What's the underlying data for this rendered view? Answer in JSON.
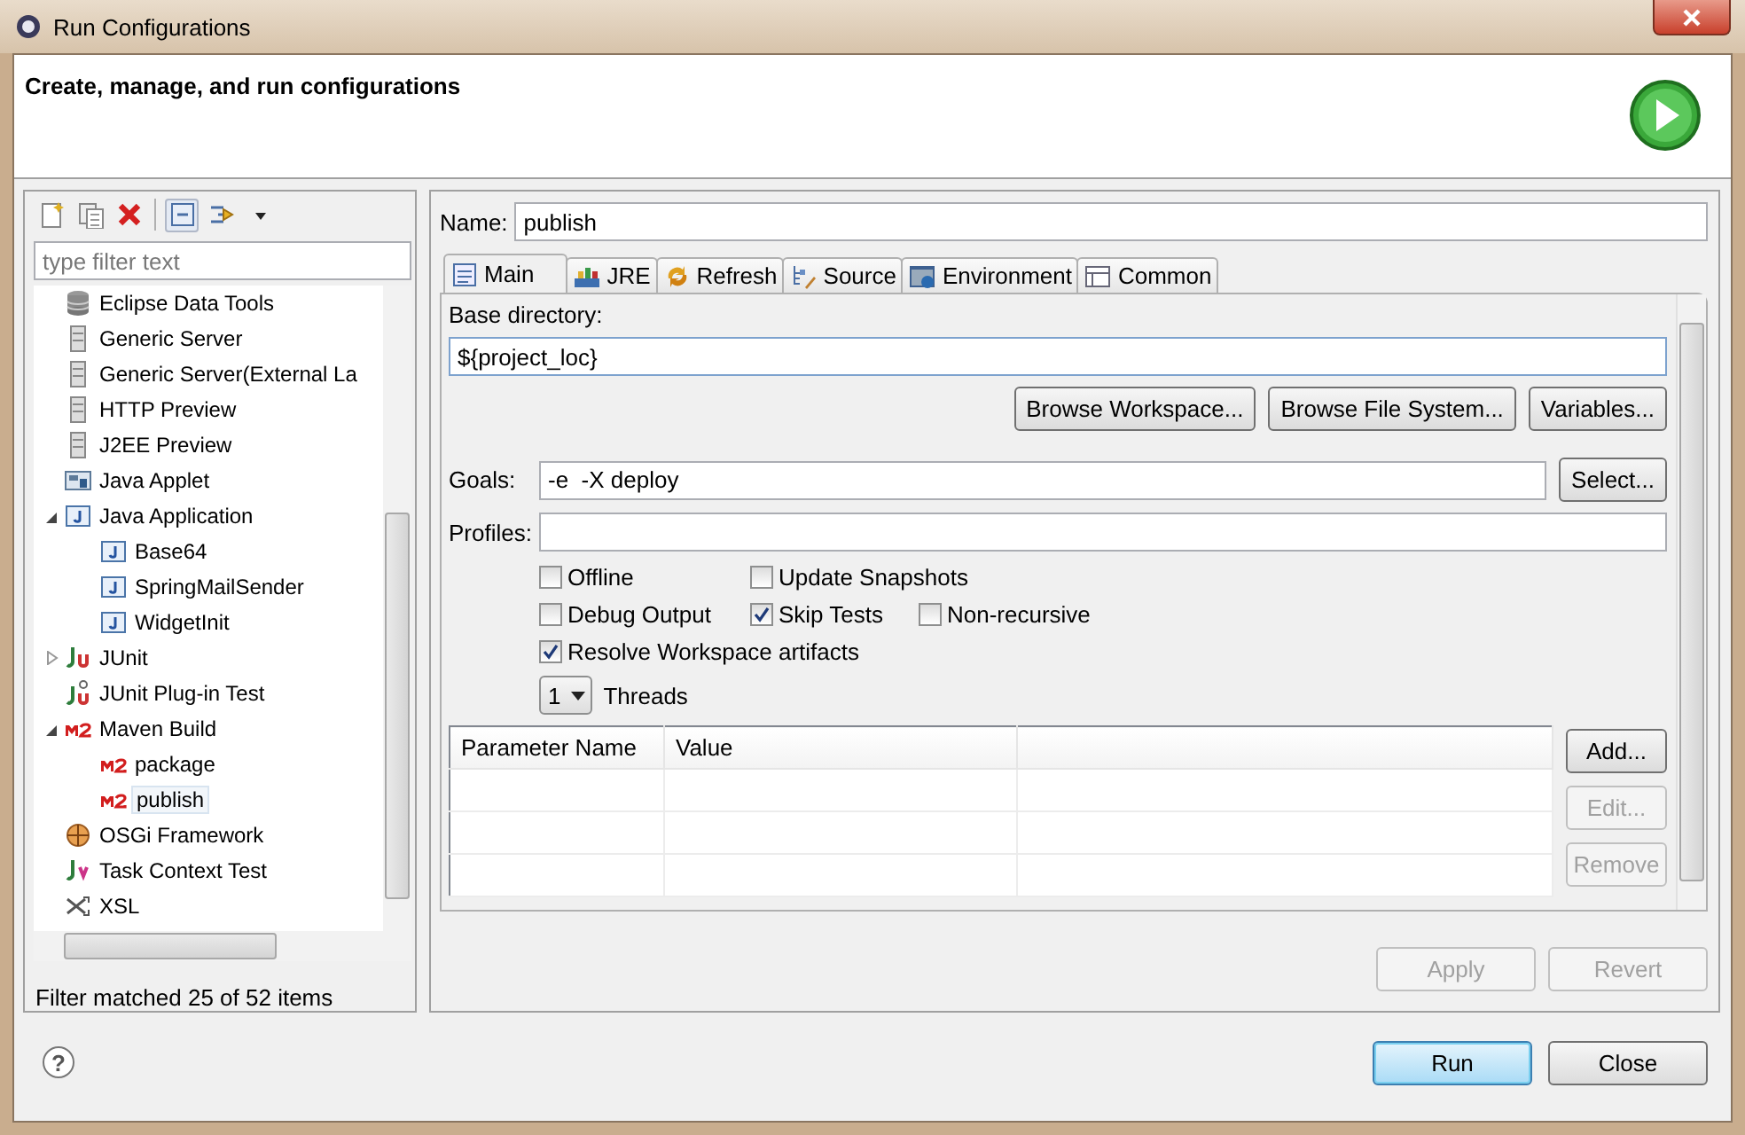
{
  "window": {
    "title": "Run Configurations"
  },
  "header": {
    "title": "Create, manage, and run configurations"
  },
  "filter": {
    "placeholder": "type filter text"
  },
  "tree": [
    {
      "label": "Eclipse Data Tools",
      "kind": "database",
      "selected": false
    },
    {
      "label": "Generic Server",
      "kind": "server",
      "selected": false
    },
    {
      "label": "Generic Server(External La",
      "kind": "server",
      "selected": false
    },
    {
      "label": "HTTP Preview",
      "kind": "server",
      "selected": false
    },
    {
      "label": "J2EE Preview",
      "kind": "server",
      "selected": false
    },
    {
      "label": "Java Applet",
      "kind": "applet",
      "selected": false
    },
    {
      "label": "Java Application",
      "kind": "java",
      "selected": false,
      "expanded": true,
      "children": [
        {
          "label": "Base64",
          "kind": "java",
          "selected": false
        },
        {
          "label": "SpringMailSender",
          "kind": "java",
          "selected": false
        },
        {
          "label": "WidgetInit",
          "kind": "java",
          "selected": false
        }
      ]
    },
    {
      "label": "JUnit",
      "kind": "junit",
      "selected": false,
      "expanded": false
    },
    {
      "label": "JUnit Plug-in Test",
      "kind": "plugin-test",
      "selected": false
    },
    {
      "label": "Maven Build",
      "kind": "maven",
      "selected": false,
      "expanded": true,
      "children": [
        {
          "label": "package",
          "kind": "maven",
          "selected": false
        },
        {
          "label": "publish",
          "kind": "maven",
          "selected": true
        }
      ]
    },
    {
      "label": "OSGi Framework",
      "kind": "osgi",
      "selected": false
    },
    {
      "label": "Task Context Test",
      "kind": "task",
      "selected": false
    },
    {
      "label": "XSL",
      "kind": "xsl",
      "selected": false
    }
  ],
  "filter_status": "Filter matched 25 of 52 items",
  "name": {
    "label": "Name:",
    "value": "publish"
  },
  "tabs": [
    {
      "label": "Main",
      "kind": "main",
      "selected": true
    },
    {
      "label": "JRE",
      "kind": "jre",
      "selected": false
    },
    {
      "label": "Refresh",
      "kind": "refresh",
      "selected": false
    },
    {
      "label": "Source",
      "kind": "source",
      "selected": false
    },
    {
      "label": "Environment",
      "kind": "environment",
      "selected": false
    },
    {
      "label": "Common",
      "kind": "common",
      "selected": false
    }
  ],
  "main": {
    "base_directory": {
      "label": "Base directory:",
      "value": "${project_loc}"
    },
    "browse_buttons": [
      "Browse Workspace...",
      "Browse File System...",
      "Variables..."
    ],
    "goals": {
      "label": "Goals:",
      "value": "-e  -X deploy",
      "button": "Select..."
    },
    "profiles": {
      "label": "Profiles:"
    },
    "options": [
      [
        {
          "label": "Offline",
          "checked": false
        },
        {
          "label": "Update Snapshots",
          "checked": false
        }
      ],
      [
        {
          "label": "Debug Output",
          "checked": false
        },
        {
          "label": "Skip Tests",
          "checked": true
        },
        {
          "label": "Non-recursive",
          "checked": false
        }
      ],
      [
        {
          "label": "Resolve Workspace artifacts",
          "checked": true
        }
      ]
    ],
    "threads": {
      "value": "1",
      "label": "Threads"
    },
    "parameters": {
      "columns": [
        "Parameter Name",
        "Value"
      ]
    },
    "parameter_buttons": [
      {
        "label": "Add...",
        "disabled": false
      },
      {
        "label": "Edit...",
        "disabled": true
      },
      {
        "label": "Remove",
        "disabled": true
      }
    ]
  },
  "apply_buttons": [
    {
      "label": "Apply",
      "disabled": true
    },
    {
      "label": "Revert",
      "disabled": true
    }
  ],
  "help": "?",
  "dialog_buttons": [
    {
      "label": "Run",
      "default": true
    },
    {
      "label": "Close",
      "default": false
    }
  ]
}
